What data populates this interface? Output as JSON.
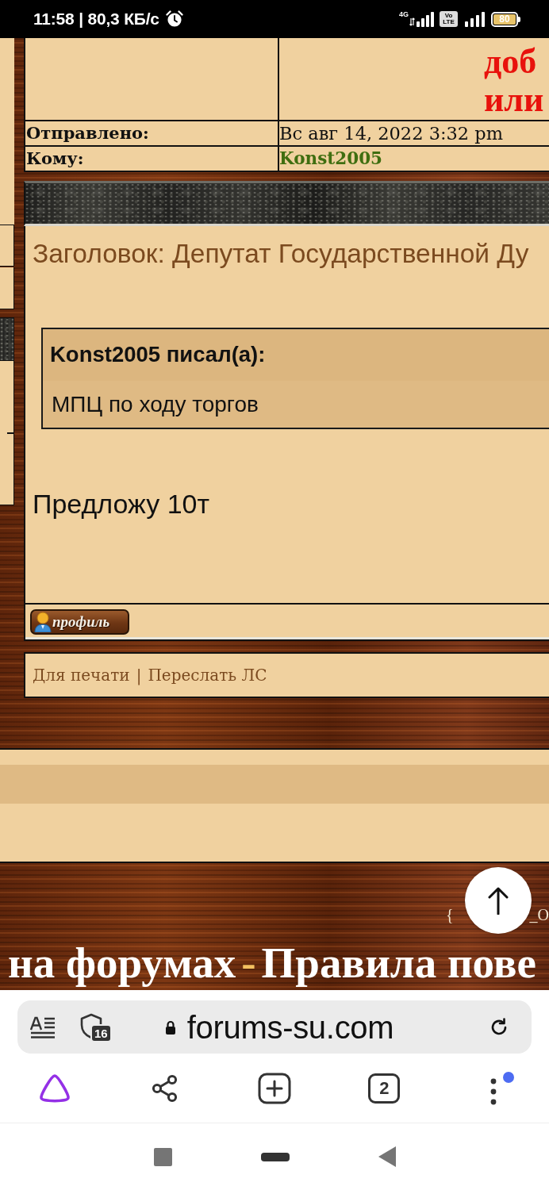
{
  "status_bar": {
    "text": "11:58 | 80,3 КБ/с",
    "network": "4G",
    "volte": "Vo LTE",
    "battery": "80"
  },
  "message": {
    "header_fragment": [
      "доб",
      "или"
    ],
    "fields": [
      {
        "label": "Отправлено:",
        "value": "Вс авг 14, 2022 3:32 pm",
        "kind": "plain"
      },
      {
        "label": "Кому:",
        "value": "Konst2005",
        "kind": "link"
      }
    ],
    "subject": "Заголовок: Депутат Государственной Ду",
    "quote": {
      "author": "Konst2005 писал(а):",
      "text": "МПЦ по ходу торгов"
    },
    "body": "Предложу 10т",
    "profile_button": "профиль",
    "actions": [
      "Для печати",
      "Переслать ЛС"
    ],
    "action_separator": "|"
  },
  "footer": {
    "fragments": [
      "{",
      "_O"
    ],
    "links": [
      "на форумах",
      "Правила пове"
    ],
    "link_separator": "-"
  },
  "browser": {
    "url": "forums-su.com",
    "tracker_count": "16",
    "tab_count": "2"
  }
}
